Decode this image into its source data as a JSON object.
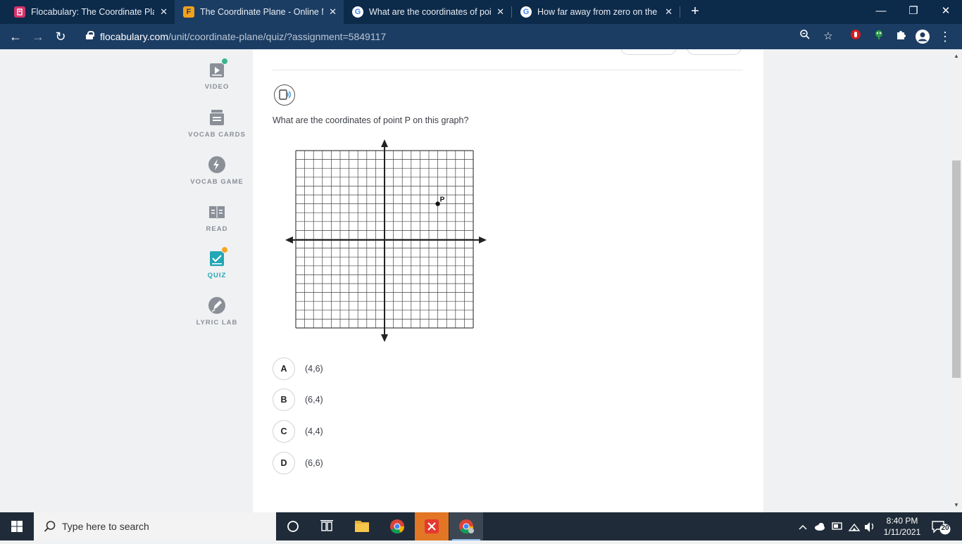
{
  "browser": {
    "tabs": [
      {
        "title": "Flocabulary: The Coordinate Plan",
        "favicon": "flocabulary-icon",
        "active": false
      },
      {
        "title": "The Coordinate Plane - Online M",
        "favicon": "flocabulary-f-icon",
        "active": true
      },
      {
        "title": "What are the coordinates of poin",
        "favicon": "google-icon",
        "active": false
      },
      {
        "title": "How far away from zero on the y",
        "favicon": "google-icon",
        "active": false
      }
    ],
    "url_host": "flocabulary.com",
    "url_path": "/unit/coordinate-plane/quiz/?assignment=5849117"
  },
  "sidebar": {
    "items": [
      {
        "label": "VIDEO",
        "icon": "video-icon"
      },
      {
        "label": "VOCAB CARDS",
        "icon": "vocab-cards-icon"
      },
      {
        "label": "VOCAB GAME",
        "icon": "lightning-icon"
      },
      {
        "label": "READ",
        "icon": "book-icon"
      },
      {
        "label": "QUIZ",
        "icon": "quiz-icon"
      },
      {
        "label": "LYRIC LAB",
        "icon": "pen-icon"
      }
    ]
  },
  "quiz": {
    "question": "What are the coordinates of point P on this graph?",
    "point_label": "P",
    "point": {
      "x": 6,
      "y": 4
    },
    "choices": [
      {
        "letter": "A",
        "text": "(4,6)"
      },
      {
        "letter": "B",
        "text": "(6,4)"
      },
      {
        "letter": "C",
        "text": "(4,4)"
      },
      {
        "letter": "D",
        "text": "(6,6)"
      }
    ]
  },
  "taskbar": {
    "search_placeholder": "Type here to search",
    "time": "8:40 PM",
    "date": "1/11/2021",
    "notification_count": "20"
  },
  "colors": {
    "accent_teal": "#23a6b5",
    "badge_green": "#3bb58c",
    "badge_orange": "#f5a623",
    "chrome_dark": "#0c2a4a",
    "chrome_toolbar": "#1c3d63"
  }
}
